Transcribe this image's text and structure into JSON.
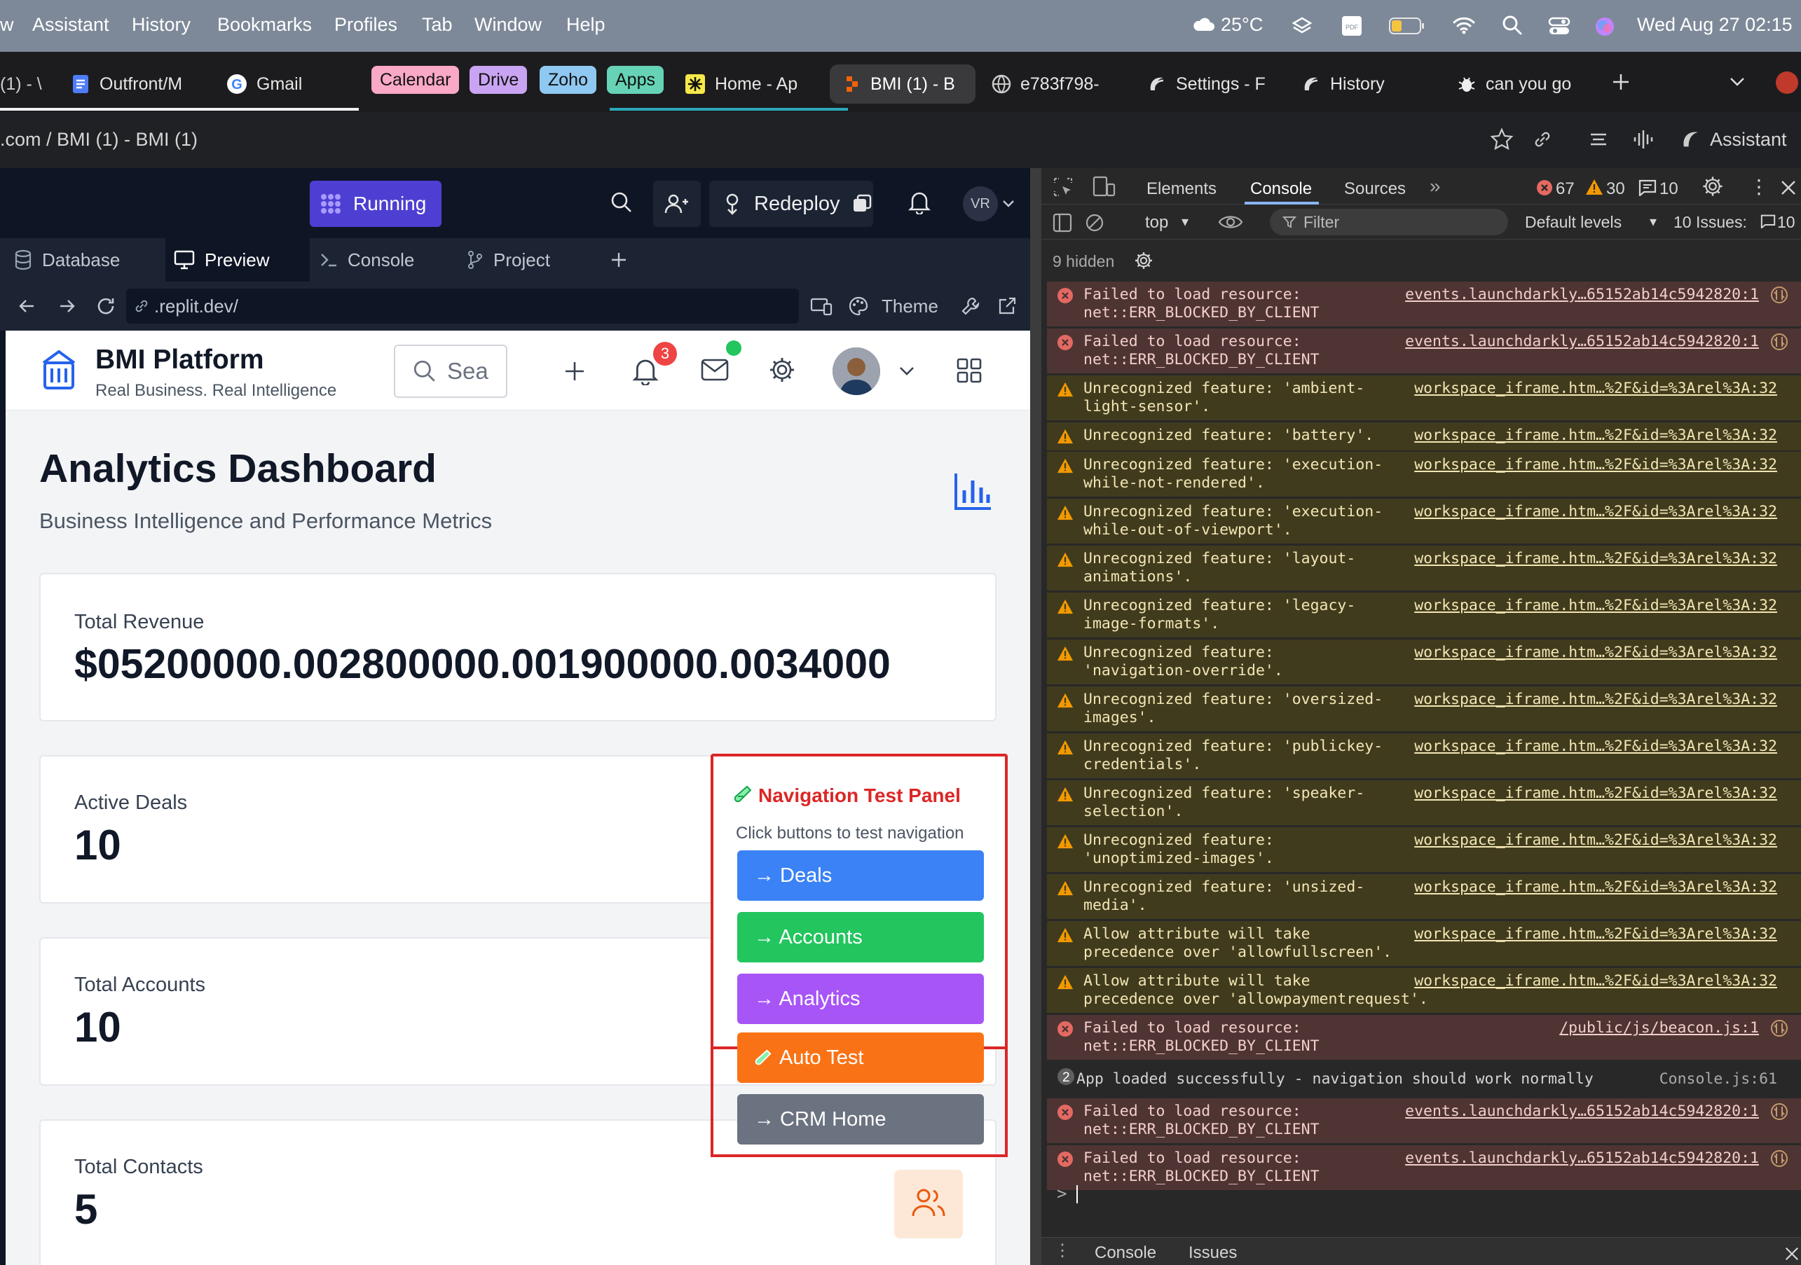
{
  "menubar": {
    "items": [
      "w",
      "Assistant",
      "History",
      "Bookmarks",
      "Profiles",
      "Tab",
      "Window",
      "Help"
    ],
    "temperature": "25°C",
    "datetime": "Wed Aug 27  02:15"
  },
  "tabs": [
    {
      "label": "(1) - \\",
      "icon": "tab-icon"
    },
    {
      "label": "Outfront/M",
      "icon": "doc-icon"
    },
    {
      "label": "Gmail",
      "icon": "google-icon"
    },
    {
      "label": "Home - Ap",
      "icon": "star-icon"
    },
    {
      "label": "BMI (1) - B",
      "icon": "replit-icon",
      "active": true
    },
    {
      "label": "e783f798-",
      "icon": "globe-icon"
    },
    {
      "label": "Settings - F",
      "icon": "assistant-icon"
    },
    {
      "label": "History",
      "icon": "assistant-icon"
    },
    {
      "label": "can you go",
      "icon": "bug-icon"
    }
  ],
  "bookmark_pills": [
    {
      "label": "Calendar",
      "color": "#f9a8c5"
    },
    {
      "label": "Drive",
      "color": "#c9a4f2"
    },
    {
      "label": "Zoho",
      "color": "#8fc8f0"
    },
    {
      "label": "Apps",
      "color": "#66d3b6"
    }
  ],
  "address": {
    "text": ".com / BMI (1) - BMI (1)",
    "assistant": "Assistant"
  },
  "replit": {
    "status": "Running",
    "redeploy": "Redeploy",
    "avatar": "VR",
    "tabs": [
      "Database",
      "Preview",
      "Console",
      "Project"
    ],
    "url": ".replit.dev/",
    "theme": "Theme"
  },
  "app": {
    "brand": "BMI Platform",
    "tagline": "Real Business. Real Intelligence",
    "search_placeholder": "Sea",
    "notif_count": "3",
    "title": "Analytics Dashboard",
    "subtitle": "Business Intelligence and Performance Metrics",
    "cards": [
      {
        "label": "Total Revenue",
        "value": "$05200000.002800000.001900000.0034000"
      },
      {
        "label": "Active Deals",
        "value": "10"
      },
      {
        "label": "Total Accounts",
        "value": "10"
      },
      {
        "label": "Total Contacts",
        "value": "5"
      }
    ],
    "test_panel": {
      "title": "Navigation Test Panel",
      "hint": "Click buttons to test navigation",
      "buttons": [
        {
          "label": "→ Deals",
          "color": "#3b82f6"
        },
        {
          "label": "→ Accounts",
          "color": "#22c55e"
        },
        {
          "label": "→ Analytics",
          "color": "#a855f7"
        },
        {
          "label": "Auto Test",
          "color": "#f97316"
        },
        {
          "label": "→ CRM Home",
          "color": "#6b7280"
        }
      ]
    }
  },
  "devtools": {
    "tabs": [
      "Elements",
      "Console",
      "Sources"
    ],
    "error_count": "67",
    "warning_count": "30",
    "info_count": "10",
    "context": "top",
    "filter_placeholder": "Filter",
    "levels": "Default levels",
    "issues": "10 Issues:",
    "issues_count": "10",
    "hidden": "9 hidden",
    "logs": [
      {
        "level": "error",
        "msg": "Failed to load resource:\nnet::ERR_BLOCKED_BY_CLIENT",
        "src": "events.launchdarkly…65152ab14c5942820:1"
      },
      {
        "level": "error",
        "msg": "Failed to load resource:\nnet::ERR_BLOCKED_BY_CLIENT",
        "src": "events.launchdarkly…65152ab14c5942820:1"
      },
      {
        "level": "warn",
        "msg": "Unrecognized feature: 'ambient-\nlight-sensor'.",
        "src": "workspace_iframe.htm…%2F&id=%3Arel%3A:32"
      },
      {
        "level": "warn",
        "msg": "Unrecognized feature: 'battery'.",
        "src": "workspace_iframe.htm…%2F&id=%3Arel%3A:32"
      },
      {
        "level": "warn",
        "msg": "Unrecognized feature: 'execution-\nwhile-not-rendered'.",
        "src": "workspace_iframe.htm…%2F&id=%3Arel%3A:32"
      },
      {
        "level": "warn",
        "msg": "Unrecognized feature: 'execution-\nwhile-out-of-viewport'.",
        "src": "workspace_iframe.htm…%2F&id=%3Arel%3A:32"
      },
      {
        "level": "warn",
        "msg": "Unrecognized feature: 'layout-\nanimations'.",
        "src": "workspace_iframe.htm…%2F&id=%3Arel%3A:32"
      },
      {
        "level": "warn",
        "msg": "Unrecognized feature: 'legacy-\nimage-formats'.",
        "src": "workspace_iframe.htm…%2F&id=%3Arel%3A:32"
      },
      {
        "level": "warn",
        "msg": "Unrecognized feature:\n'navigation-override'.",
        "src": "workspace_iframe.htm…%2F&id=%3Arel%3A:32"
      },
      {
        "level": "warn",
        "msg": "Unrecognized feature: 'oversized-\nimages'.",
        "src": "workspace_iframe.htm…%2F&id=%3Arel%3A:32"
      },
      {
        "level": "warn",
        "msg": "Unrecognized feature: 'publickey-\ncredentials'.",
        "src": "workspace_iframe.htm…%2F&id=%3Arel%3A:32"
      },
      {
        "level": "warn",
        "msg": "Unrecognized feature: 'speaker-\nselection'.",
        "src": "workspace_iframe.htm…%2F&id=%3Arel%3A:32"
      },
      {
        "level": "warn",
        "msg": "Unrecognized feature:\n'unoptimized-images'.",
        "src": "workspace_iframe.htm…%2F&id=%3Arel%3A:32"
      },
      {
        "level": "warn",
        "msg": "Unrecognized feature: 'unsized-\nmedia'.",
        "src": "workspace_iframe.htm…%2F&id=%3Arel%3A:32"
      },
      {
        "level": "warn",
        "msg": "Allow attribute will take\nprecedence over 'allowfullscreen'.",
        "src": "workspace_iframe.htm…%2F&id=%3Arel%3A:32"
      },
      {
        "level": "warn",
        "msg": "Allow attribute will take\nprecedence over 'allowpaymentrequest'.",
        "src": "workspace_iframe.htm…%2F&id=%3Arel%3A:32"
      },
      {
        "level": "error",
        "msg": "Failed to load resource:\nnet::ERR_BLOCKED_BY_CLIENT",
        "src": "/public/js/beacon.js:1"
      },
      {
        "level": "info",
        "count": "2",
        "msg": "App loaded successfully - navigation should work normally",
        "src": "Console.js:61"
      },
      {
        "level": "error",
        "msg": "Failed to load resource:\nnet::ERR_BLOCKED_BY_CLIENT",
        "src": "events.launchdarkly…65152ab14c5942820:1"
      },
      {
        "level": "error",
        "msg": "Failed to load resource:\nnet::ERR_BLOCKED_BY_CLIENT",
        "src": "events.launchdarkly…65152ab14c5942820:1"
      }
    ],
    "prompt": ">",
    "drawer_tabs": [
      "Console",
      "Issues"
    ]
  }
}
